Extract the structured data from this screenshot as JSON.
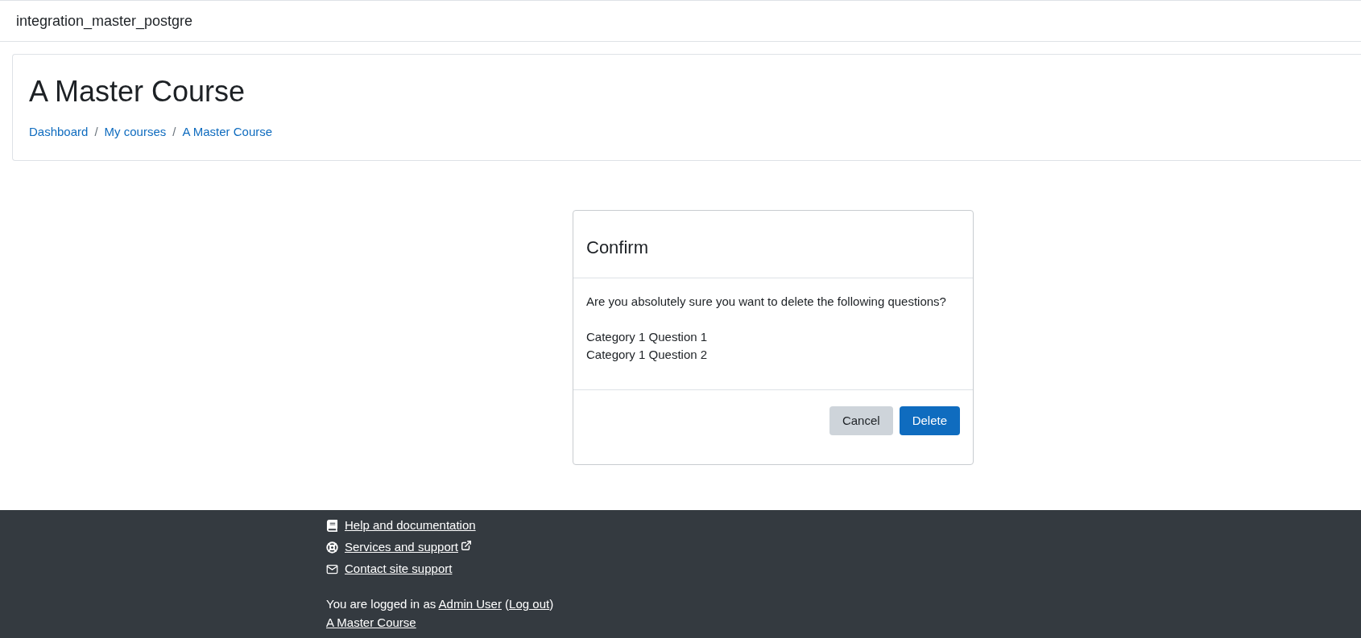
{
  "navbar": {
    "site_name": "integration_master_postgre"
  },
  "header": {
    "title": "A Master Course",
    "breadcrumbs": [
      "Dashboard",
      "My courses",
      "A Master Course"
    ],
    "separator": "/"
  },
  "dialog": {
    "title": "Confirm",
    "message": "Are you absolutely sure you want to delete the following questions?",
    "items": [
      "Category 1 Question 1",
      "Category 1 Question 2"
    ],
    "buttons": [
      {
        "label": "Cancel",
        "kind": "secondary"
      },
      {
        "label": "Delete",
        "kind": "primary"
      }
    ]
  },
  "footer": {
    "links": [
      {
        "label": "Help and documentation",
        "external": false
      },
      {
        "label": "Services and support",
        "external": true
      },
      {
        "label": "Contact site support",
        "external": false
      }
    ],
    "login": {
      "prefix": "You are logged in as",
      "user": "Admin User",
      "open": "(",
      "logout": "Log out",
      "close": ")"
    },
    "course_link": "A Master Course"
  }
}
